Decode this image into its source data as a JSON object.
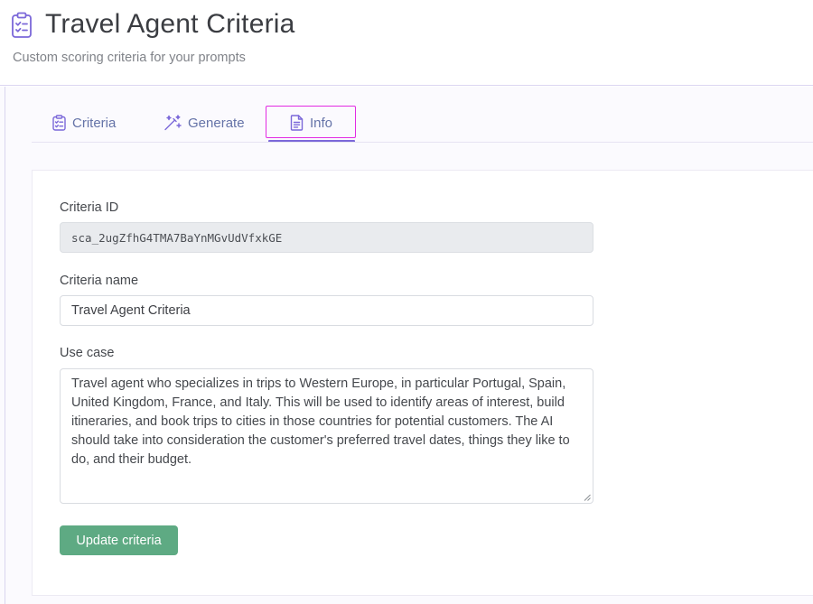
{
  "header": {
    "title": "Travel Agent Criteria",
    "subtitle": "Custom scoring criteria for your prompts",
    "icon": "clipboard-checklist-icon"
  },
  "tabs": [
    {
      "label": "Criteria",
      "icon": "clipboard-icon",
      "active": false
    },
    {
      "label": "Generate",
      "icon": "magic-wand-icon",
      "active": false
    },
    {
      "label": "Info",
      "icon": "document-icon",
      "active": true
    }
  ],
  "colors": {
    "accent": "#7b68d9",
    "tab_text": "#6573a8",
    "highlight": "#e22be3",
    "button": "#5eaa83"
  },
  "form": {
    "criteria_id_label": "Criteria ID",
    "criteria_id_value": "sca_2ugZfhG4TMA7BaYnMGvUdVfxkGE",
    "criteria_name_label": "Criteria name",
    "criteria_name_value": "Travel Agent Criteria",
    "use_case_label": "Use case",
    "use_case_value": "Travel agent who specializes in trips to Western Europe, in particular Portugal, Spain, United Kingdom, France, and Italy. This will be used to identify areas of interest, build itineraries, and book trips to cities in those countries for potential customers. The AI should take into consideration the customer's preferred travel dates, things they like to do, and their budget.",
    "submit_label": "Update criteria"
  }
}
